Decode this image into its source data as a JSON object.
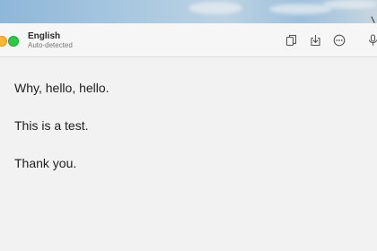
{
  "header": {
    "language": "English",
    "language_status": "Auto-detected"
  },
  "toolbar": {
    "icons": [
      "copy-icon",
      "download-icon",
      "more-icon",
      "microphone-icon"
    ]
  },
  "content": {
    "lines": [
      "Why, hello, hello.",
      "This is a test.",
      "Thank you."
    ]
  },
  "colors": {
    "traffic_yellow": "#f5b73a",
    "traffic_green": "#33c748",
    "text": "#1d1d1d"
  }
}
